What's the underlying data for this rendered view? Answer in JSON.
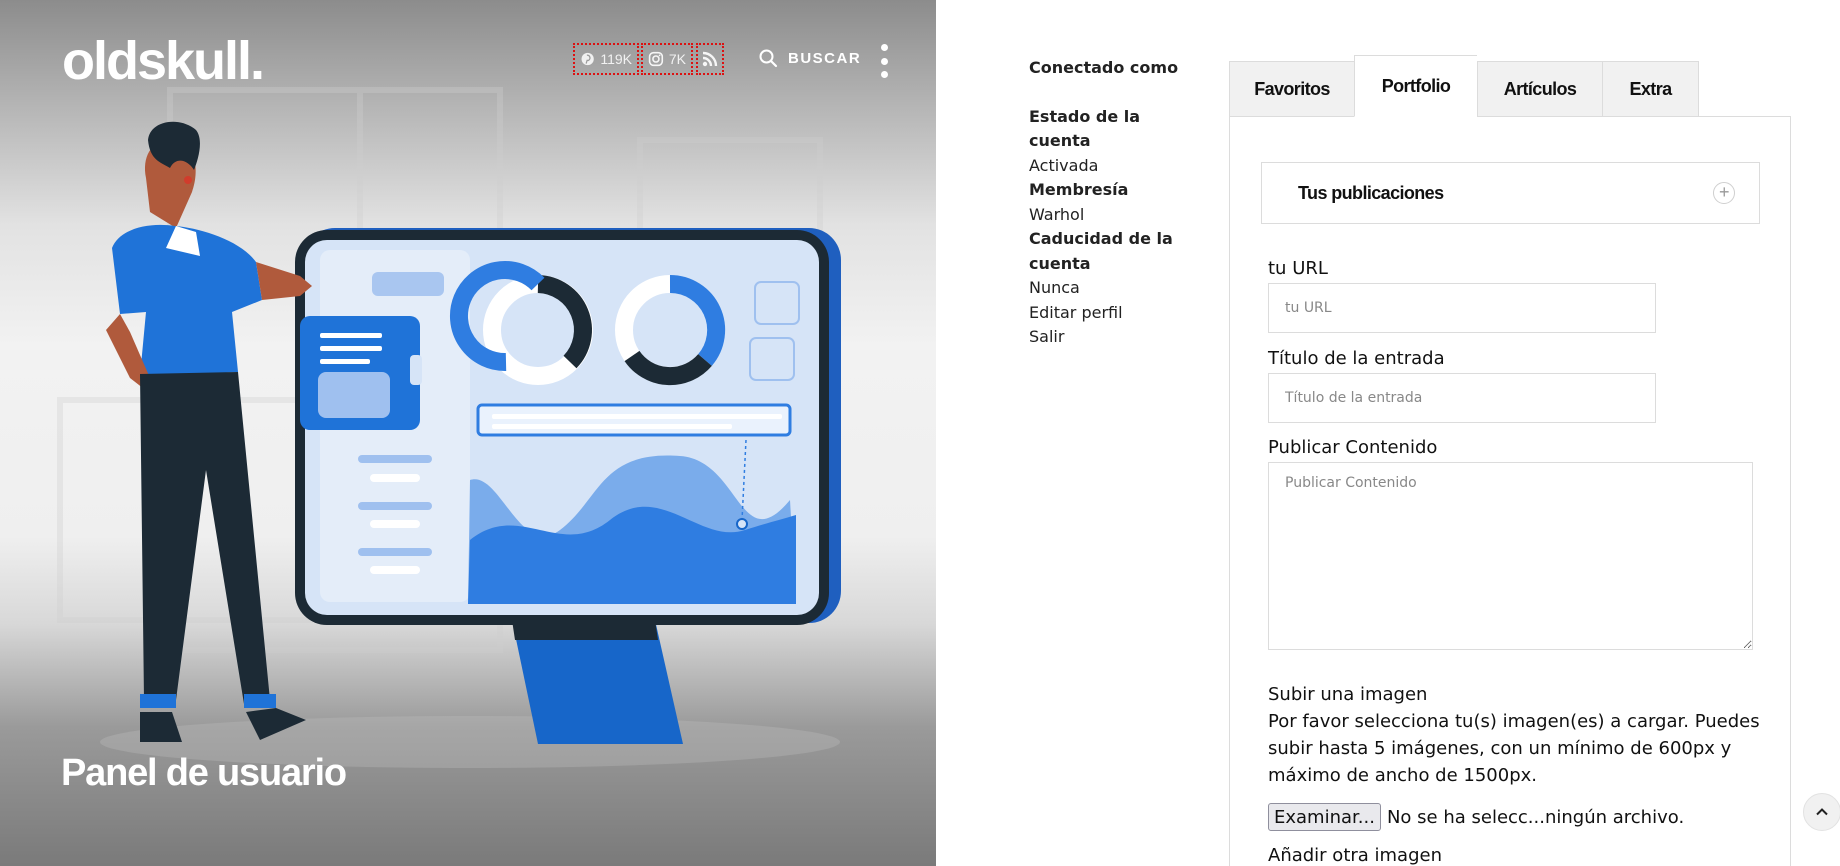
{
  "header": {
    "logo": "oldskull.",
    "social": [
      {
        "icon": "pinterest-icon",
        "count": "119K"
      },
      {
        "icon": "instagram-icon",
        "count": "7K"
      },
      {
        "icon": "rss-icon",
        "count": ""
      }
    ],
    "search_label": "BUSCAR"
  },
  "hero": {
    "title": "Panel de usuario"
  },
  "account": {
    "connected_as": "Conectado como",
    "status_label": "Estado de la cuenta",
    "status_value": "Activada",
    "membership_label": "Membresía",
    "membership_value": "Warhol",
    "expiry_label": "Caducidad de la cuenta",
    "expiry_value": "Nunca",
    "edit_profile": "Editar perfil",
    "logout": "Salir"
  },
  "tabs": [
    {
      "label": "Favoritos"
    },
    {
      "label": "Portfolio",
      "active": true
    },
    {
      "label": "Artículos"
    },
    {
      "label": "Extra"
    }
  ],
  "accordion": {
    "title": "Tus publicaciones",
    "toggle": "+"
  },
  "form": {
    "url_label": "tu URL",
    "url_placeholder": "tu URL",
    "title_label": "Título de la entrada",
    "title_placeholder": "Título de la entrada",
    "content_label": "Publicar Contenido",
    "content_placeholder": "Publicar Contenido",
    "upload_label": "Subir una imagen",
    "upload_help": "Por favor selecciona tu(s) imagen(es) a cargar. Puedes subir hasta 5 imágenes, con un mínimo de 600px y máximo de ancho de 1500px.",
    "browse_button": "Examinar...",
    "no_file": "No se ha selecc...ningún archivo.",
    "add_image": "Añadir otra imagen"
  },
  "colors": {
    "accent_blue": "#2f7de1",
    "dark_navy": "#1c2a35",
    "selection_outline": "#dd1111"
  }
}
